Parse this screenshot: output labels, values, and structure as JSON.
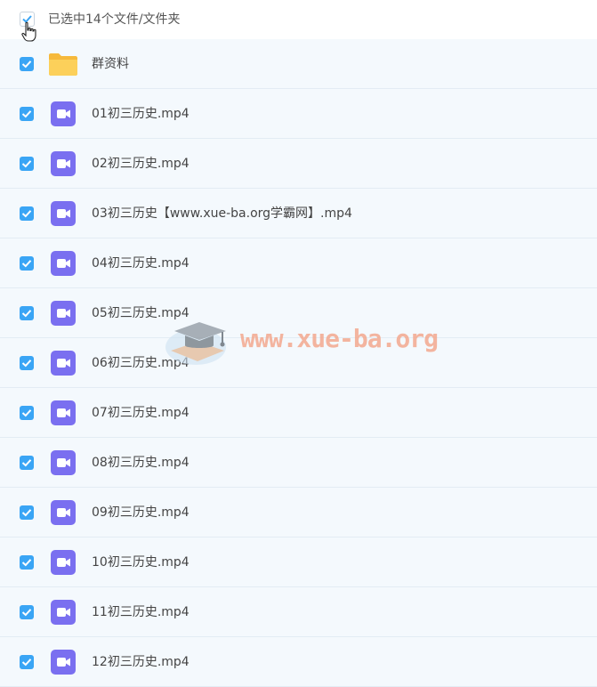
{
  "header": {
    "selection_text": "已选中14个文件/文件夹"
  },
  "files": [
    {
      "name": "群资料",
      "type": "folder"
    },
    {
      "name": "01初三历史.mp4",
      "type": "video"
    },
    {
      "name": "02初三历史.mp4",
      "type": "video"
    },
    {
      "name": "03初三历史【www.xue-ba.org学霸网】.mp4",
      "type": "video"
    },
    {
      "name": "04初三历史.mp4",
      "type": "video"
    },
    {
      "name": "05初三历史.mp4",
      "type": "video"
    },
    {
      "name": "06初三历史.mp4",
      "type": "video"
    },
    {
      "name": "07初三历史.mp4",
      "type": "video"
    },
    {
      "name": "08初三历史.mp4",
      "type": "video"
    },
    {
      "name": "09初三历史.mp4",
      "type": "video"
    },
    {
      "name": "10初三历史.mp4",
      "type": "video"
    },
    {
      "name": "11初三历史.mp4",
      "type": "video"
    },
    {
      "name": "12初三历史.mp4",
      "type": "video"
    }
  ],
  "watermark": {
    "text": "www.xue-ba.org"
  },
  "colors": {
    "checkbox": "#3aa5f5",
    "video_icon": "#7a6ff0",
    "folder_icon": "#fbc94a",
    "row_bg": "#f4f9fd",
    "watermark": "#f3a98f"
  },
  "icons": {
    "checkbox": "checkmark-icon",
    "folder": "folder-icon",
    "video": "video-file-icon",
    "cursor": "hand-cursor-icon"
  }
}
